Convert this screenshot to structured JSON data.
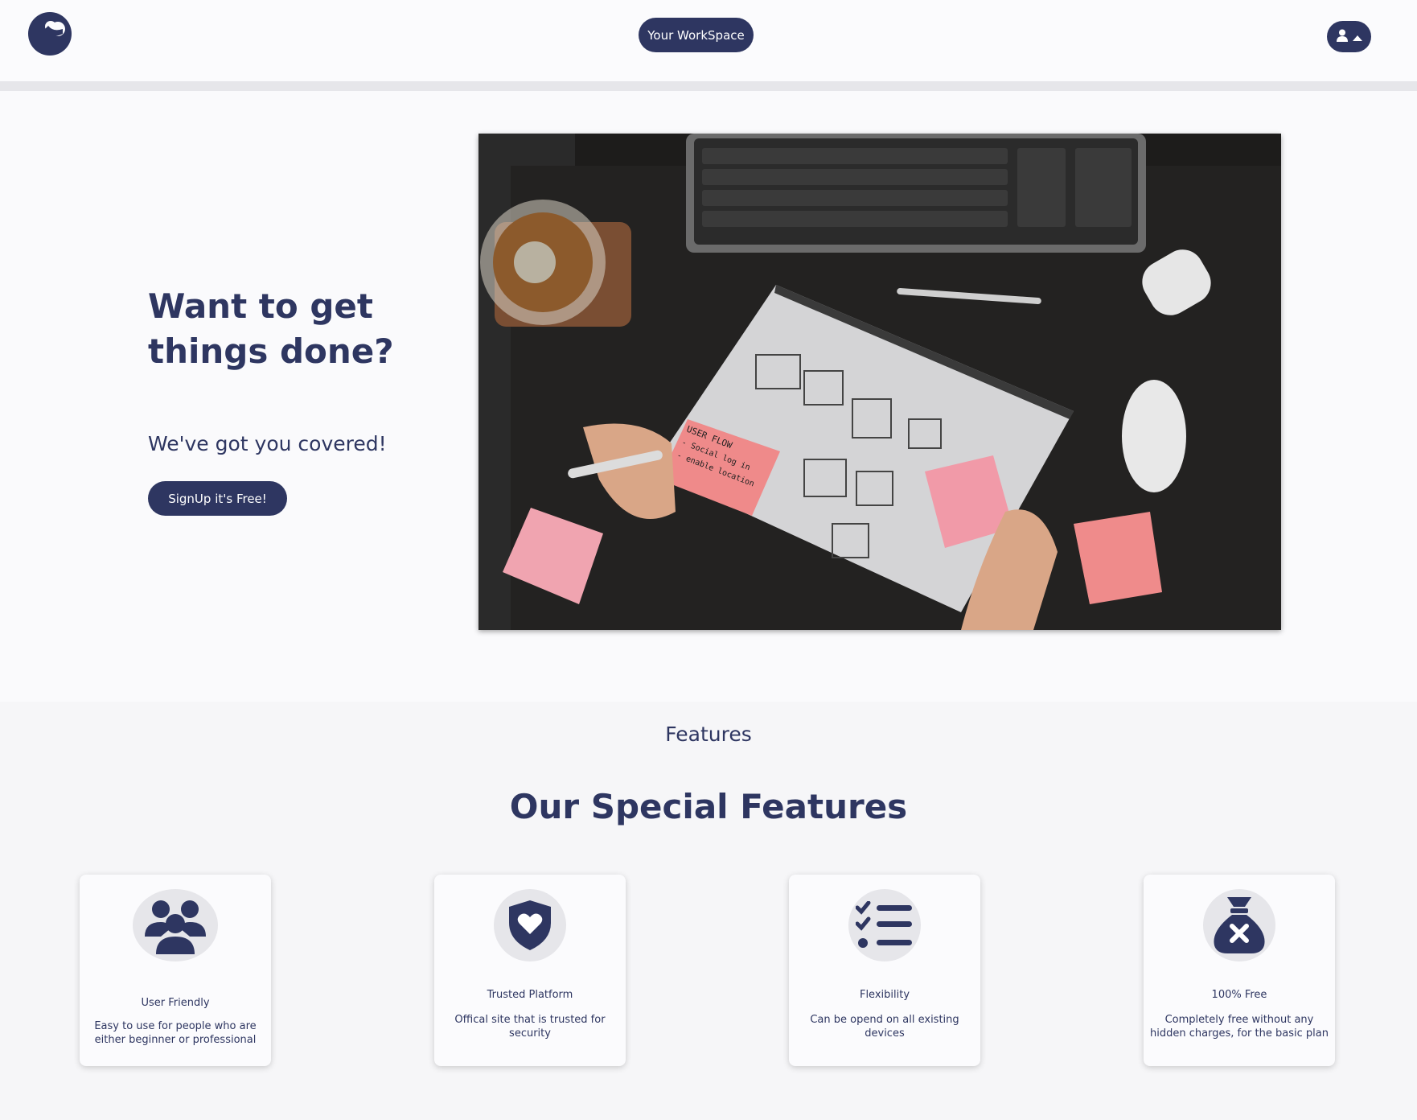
{
  "header": {
    "workspace_label": "Your WorkSpace",
    "logo_icon": "app-logo-icon",
    "user_icon": "user-icon",
    "menu_icon": "caret-up-icon"
  },
  "hero": {
    "title": "Want to get things done?",
    "subtitle": "We've got you covered!",
    "signup_label": "SignUp it's Free!",
    "note_text": [
      "USER FLOW",
      "- Social log in",
      "- enable location"
    ]
  },
  "features": {
    "label": "Features",
    "title": "Our Special Features",
    "cards": [
      {
        "icon": "users-icon",
        "title": "User Friendly",
        "description": "Easy to use for people who are either beginner or professional"
      },
      {
        "icon": "shield-heart-icon",
        "title": "Trusted Platform",
        "description": "Offical site that is trusted for security"
      },
      {
        "icon": "list-check-icon",
        "title": "Flexibility",
        "description": "Can be opend on all existing devices"
      },
      {
        "icon": "money-bag-icon",
        "title": "100% Free",
        "description": "Completely free without any hidden charges, for the basic plan"
      }
    ]
  },
  "colors": {
    "primary": "#2e3661",
    "background": "#fafafc",
    "section_bg": "#f6f6f8",
    "icon_circle": "#e6e6ea"
  }
}
